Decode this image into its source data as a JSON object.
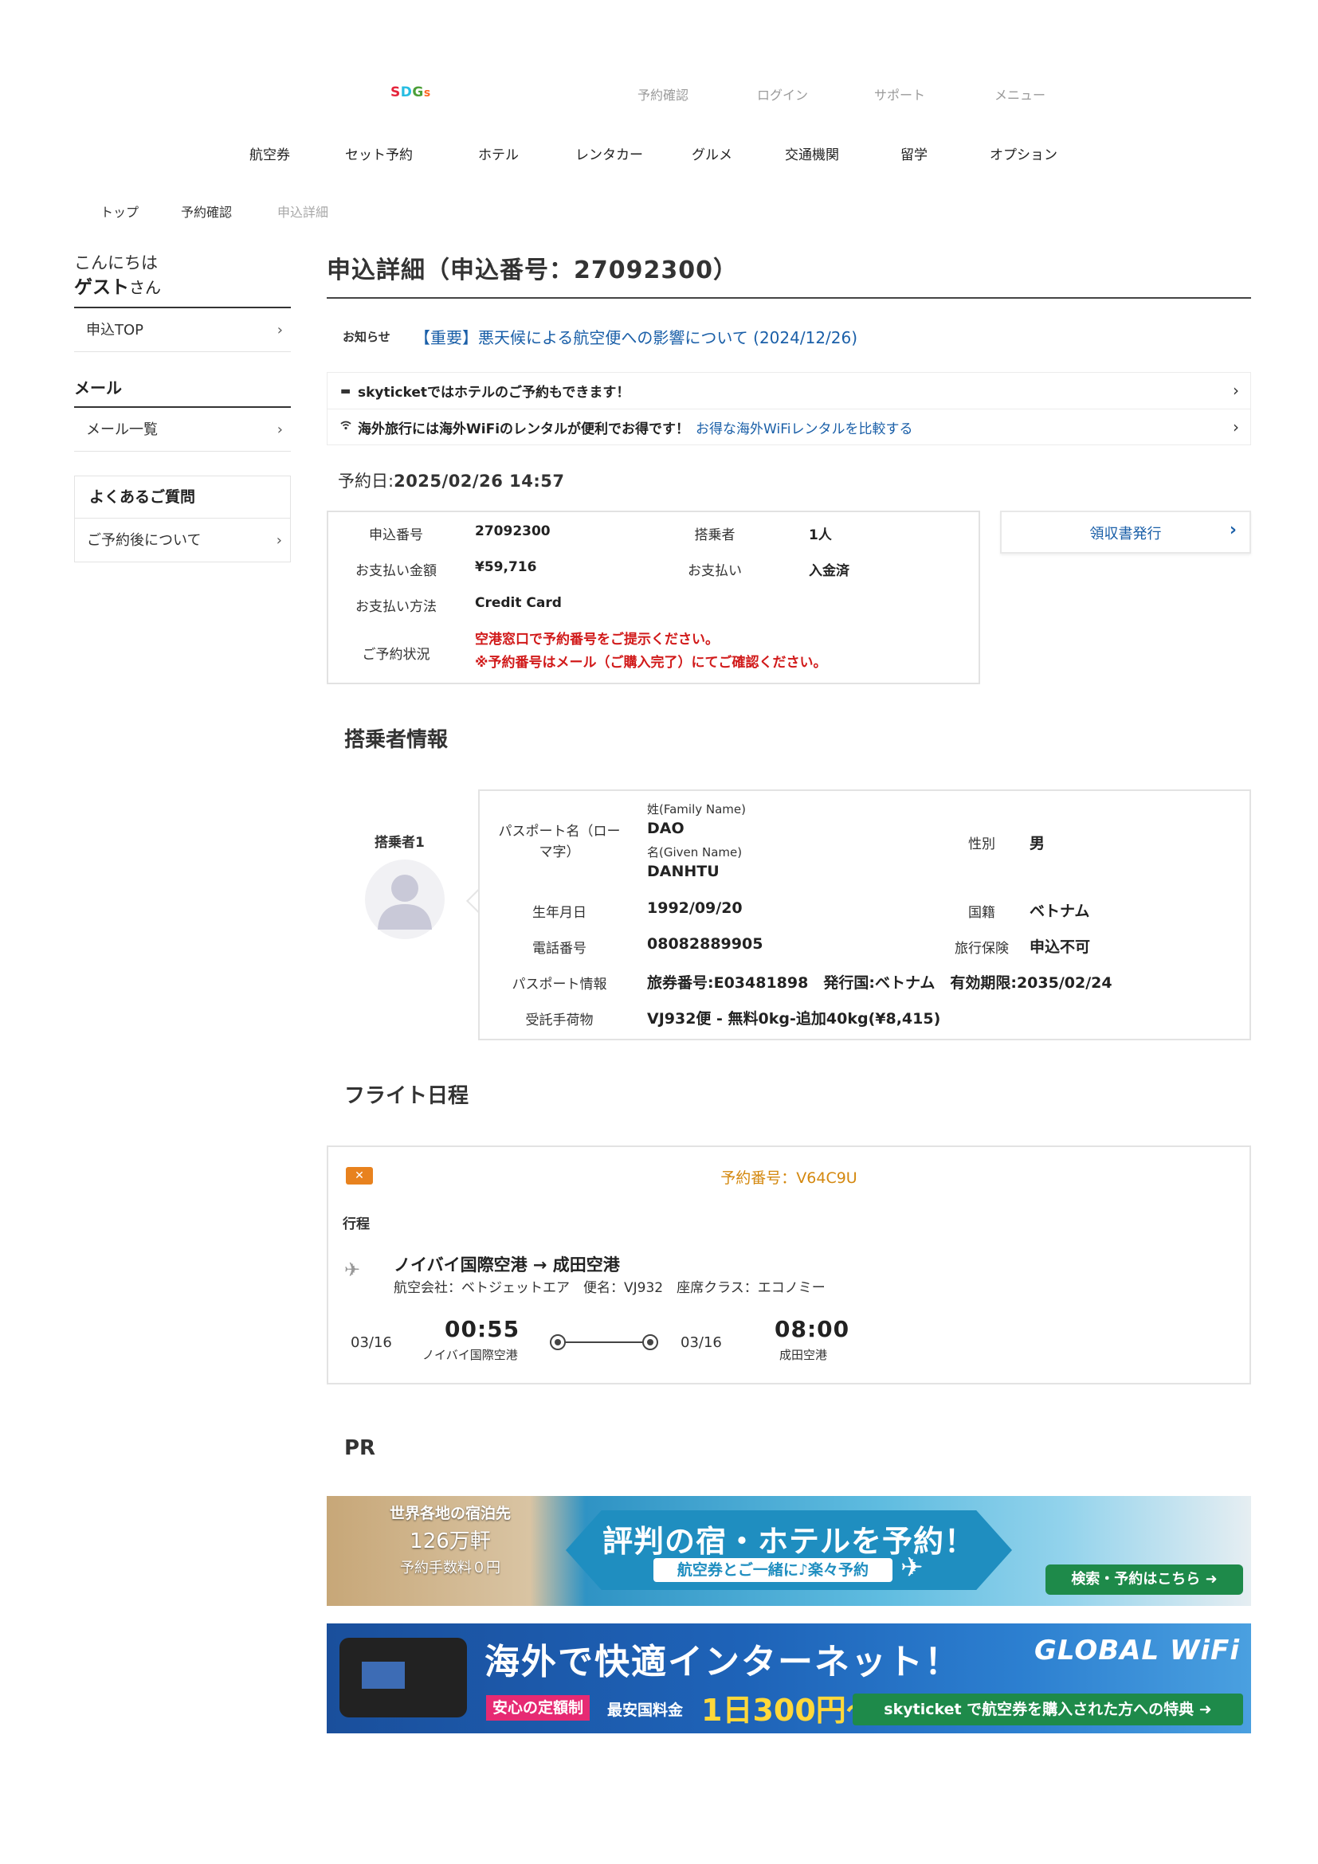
{
  "header": {
    "logo": [
      "S",
      "D",
      "G",
      "s"
    ],
    "links": [
      "予約確認",
      "ログイン",
      "サポート",
      "メニュー"
    ]
  },
  "nav": [
    "航空券",
    "セット予約",
    "ホテル",
    "レンタカー",
    "グルメ",
    "交通機関",
    "留学",
    "オプション"
  ],
  "breadcrumb": [
    "トップ",
    "予約確認",
    "申込詳細"
  ],
  "sidebar": {
    "hello": "こんにちは",
    "guest_name": "ゲスト",
    "guest_suffix": "さん",
    "top_link": "申込TOP",
    "mail_heading": "メール",
    "mail_link": "メール一覧",
    "faq_heading": "よくあるご質問",
    "faq_link": "ご予約後について",
    "chevron": "›"
  },
  "main": {
    "title": "申込詳細（申込番号：27092300）",
    "notice_label": "お知らせ",
    "notice_text": "【重要】悪天候による航空便への影響について (2024/12/26)",
    "promo_hotel": "skyticketではホテルのご予約もできます！",
    "promo_wifi": "海外旅行には海外WiFiのレンタルが便利でお得です！",
    "promo_wifi_link": "お得な海外WiFiレンタルを比較する",
    "reservation_date_label": "予約日:",
    "reservation_date": "2025/02/26 14:57"
  },
  "summary": {
    "app_no_label": "申込番号",
    "app_no": "27092300",
    "pax_label": "搭乗者",
    "pax": "1人",
    "amount_label": "お支払い金額",
    "amount": "¥59,716",
    "payment_label": "お支払い",
    "payment": "入金済",
    "method_label": "お支払い方法",
    "method": "Credit Card",
    "status_label": "ご予約状況",
    "status_line1": "空港窓口で予約番号をご提示ください。",
    "status_line2": "※予約番号はメール（ご購入完了）にてご確認ください。",
    "receipt": "領収書発行"
  },
  "passenger": {
    "section_title": "搭乗者情報",
    "label": "搭乗者1",
    "name_label": "パスポート名（ローマ字）",
    "family_label": "姓(Family Name)",
    "family": "DAO",
    "given_label": "名(Given Name)",
    "given": "DANHTU",
    "gender_label": "性別",
    "gender": "男",
    "dob_label": "生年月日",
    "dob": "1992/09/20",
    "nationality_label": "国籍",
    "nationality": "ベトナム",
    "phone_label": "電話番号",
    "phone": "08082889905",
    "insurance_label": "旅行保険",
    "insurance": "申込不可",
    "passport_label": "パスポート情報",
    "passport": "旅券番号:E03481898　発行国:ベトナム　有効期限:2035/02/24",
    "baggage_label": "受託手荷物",
    "baggage": "VJ932便 - 無料0kg-追加40kg(¥8,415)"
  },
  "flight": {
    "section_title": "フライト日程",
    "reservation": "予約番号：V64C9U",
    "itinerary_label": "行程",
    "route": "ノイバイ国際空港 → 成田空港",
    "details": "航空会社：ベトジェットエア　便名：VJ932　座席クラス：エコノミー",
    "dep_date": "03/16",
    "dep_time": "00:55",
    "dep_airport": "ノイバイ国際空港",
    "arr_date": "03/16",
    "arr_time": "08:00",
    "arr_airport": "成田空港"
  },
  "pr": {
    "title": "PR",
    "banner1": {
      "line1": "世界各地の宿泊先",
      "line2": "126万軒",
      "line3": "予約手数料０円",
      "title": "評判の宿・ホテルを予約！",
      "sub": "航空券とご一緒に♪楽々予約",
      "cta": "検索・予約はこちら ➜"
    },
    "banner2": {
      "title": "海外で快適インターネット！",
      "brand": "GLOBAL WiFi",
      "tag": "安心の定額制",
      "price_label": "最安国料金",
      "price": "1日300円～",
      "perk": "skyticket で航空券を購入された方への特典 ➜"
    }
  },
  "colors": {
    "accent_blue": "#1a5fa8",
    "alert_red": "#d11a1a",
    "reservation_orange": "#d4880f"
  }
}
